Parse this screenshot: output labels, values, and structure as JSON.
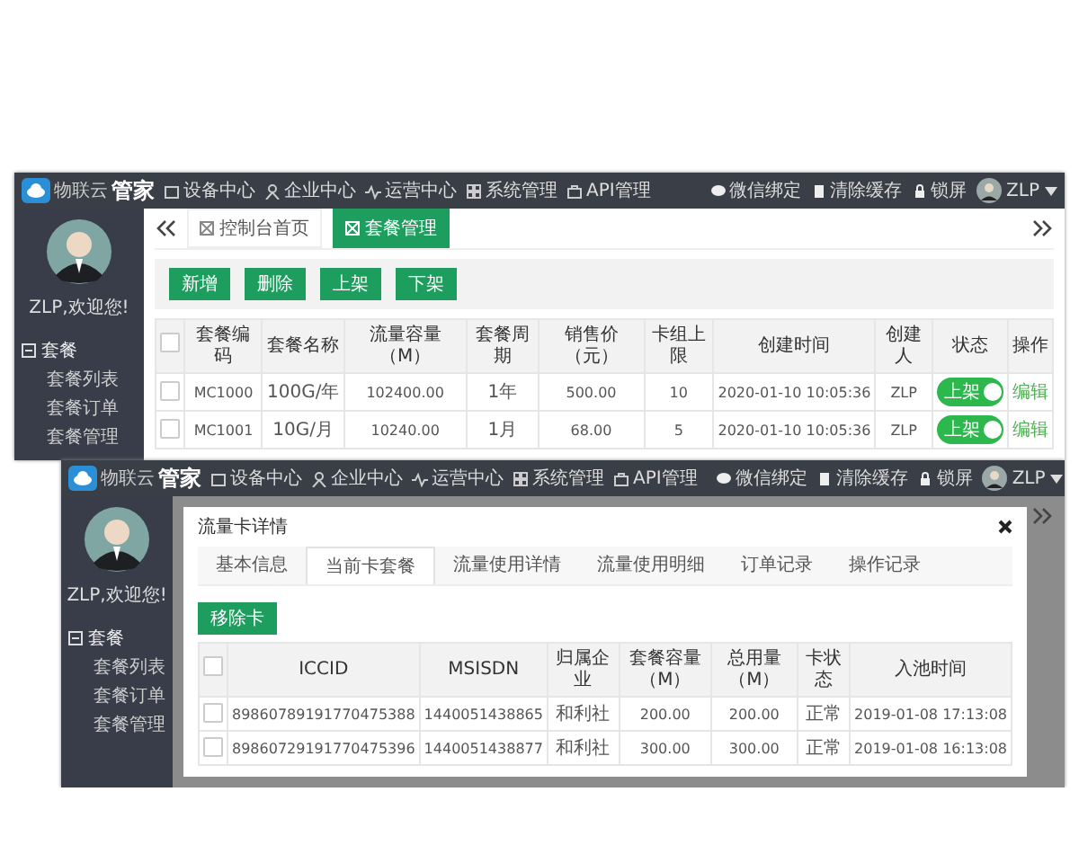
{
  "screenshots": [
    {
      "kind": "list",
      "logo_small": "物联云",
      "logo": "管家",
      "nav": [
        "设备中心",
        "企业中心",
        "运营中心",
        "系统管理",
        "API管理"
      ],
      "actions": [
        "微信绑定",
        "清除缓存",
        "锁屏"
      ],
      "user": "ZLP",
      "welcome": "ZLP,欢迎您!",
      "menu": {
        "label": "套餐",
        "expanded": true,
        "items": [
          "套餐列表",
          "套餐订单",
          "套餐管理"
        ]
      },
      "tabs": [
        {
          "label": "控制台首页",
          "selected": false
        },
        {
          "label": "套餐管理",
          "selected": true
        }
      ],
      "toolbar": [
        "新增",
        "删除",
        "上架",
        "下架"
      ],
      "table": {
        "all_checked": false,
        "columns": [
          "套餐编码",
          "套餐名称",
          "流量容量（M）",
          "套餐周期",
          "销售价（元）",
          "卡组上限",
          "创建时间",
          "创建人",
          "状态",
          "操作"
        ],
        "rows": [
          {
            "checked": false,
            "cells": [
              "MC1000",
              "100G/年",
              "102400.00",
              "1年",
              "500.00",
              "10",
              "2020-01-10 10:05:36",
              "ZLP"
            ],
            "status": {
              "label": "上架",
              "on": true
            },
            "action": "编辑"
          },
          {
            "checked": false,
            "cells": [
              "MC1001",
              "10G/月",
              "10240.00",
              "1月",
              "68.00",
              "5",
              "2020-01-10 10:05:36",
              "ZLP"
            ],
            "status": {
              "label": "上架",
              "on": true
            },
            "action": "编辑"
          }
        ]
      }
    },
    {
      "kind": "detail",
      "logo_small": "物联云",
      "logo": "管家",
      "nav": [
        "设备中心",
        "企业中心",
        "运营中心",
        "系统管理",
        "API管理"
      ],
      "actions": [
        "微信绑定",
        "清除缓存",
        "锁屏"
      ],
      "user": "ZLP",
      "welcome": "ZLP,欢迎您!",
      "menu": {
        "label": "套餐",
        "expanded": true,
        "items": [
          "套餐列表",
          "套餐订单",
          "套餐管理"
        ]
      },
      "dialog": {
        "title": "流量卡详情",
        "tabs": [
          {
            "label": "基本信息",
            "selected": false
          },
          {
            "label": "当前卡套餐",
            "selected": true
          },
          {
            "label": "流量使用详情",
            "selected": false
          },
          {
            "label": "流量使用明细",
            "selected": false
          },
          {
            "label": "订单记录",
            "selected": false
          },
          {
            "label": "操作记录",
            "selected": false
          }
        ],
        "button": "移除卡",
        "table": {
          "all_checked": false,
          "columns": [
            "ICCID",
            "MSISDN",
            "归属企业",
            "套餐容量（M）",
            "总用量（M）",
            "卡状态",
            "入池时间"
          ],
          "rows": [
            {
              "checked": false,
              "cells": [
                "89860789191770475388",
                "1440051438865",
                "和利社",
                "200.00",
                "200.00",
                "正常",
                "2019-01-08 17:13:08"
              ]
            },
            {
              "checked": false,
              "cells": [
                "89860729191770475396",
                "1440051438877",
                "和利社",
                "300.00",
                "300.00",
                "正常",
                "2019-01-08 16:13:08"
              ]
            }
          ]
        }
      }
    }
  ]
}
